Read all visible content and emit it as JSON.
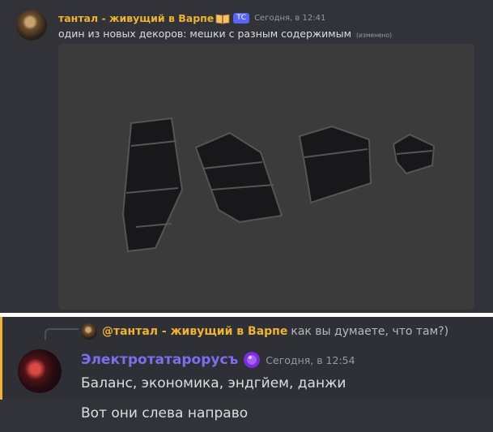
{
  "messages": {
    "first": {
      "author": "тантал - живущий в Варпе",
      "badge": "ТС",
      "timestamp": "Сегодня, в 12:41",
      "text": "один из новых декоров: мешки с разным содержимым",
      "edited": "(изменено)"
    },
    "second": {
      "reply": {
        "author": "@тантал - живущий в Варпе",
        "text": "как вы думаете, что там?)"
      },
      "author": "Электротатарорусъ",
      "timestamp": "Сегодня, в 12:54",
      "text": "Баланс, экономика, эндгйем, данжи"
    },
    "third": {
      "text": "Вот они слева направо"
    }
  },
  "colors": {
    "background": "#313338",
    "highlight": "#2e3035",
    "author_orange": "#f0b232",
    "author_purple": "#7f6cf0",
    "tag_blue": "#5865f2"
  },
  "icons": {
    "author_badge": "open-book-icon",
    "role_badge": "purple-orb-icon"
  }
}
